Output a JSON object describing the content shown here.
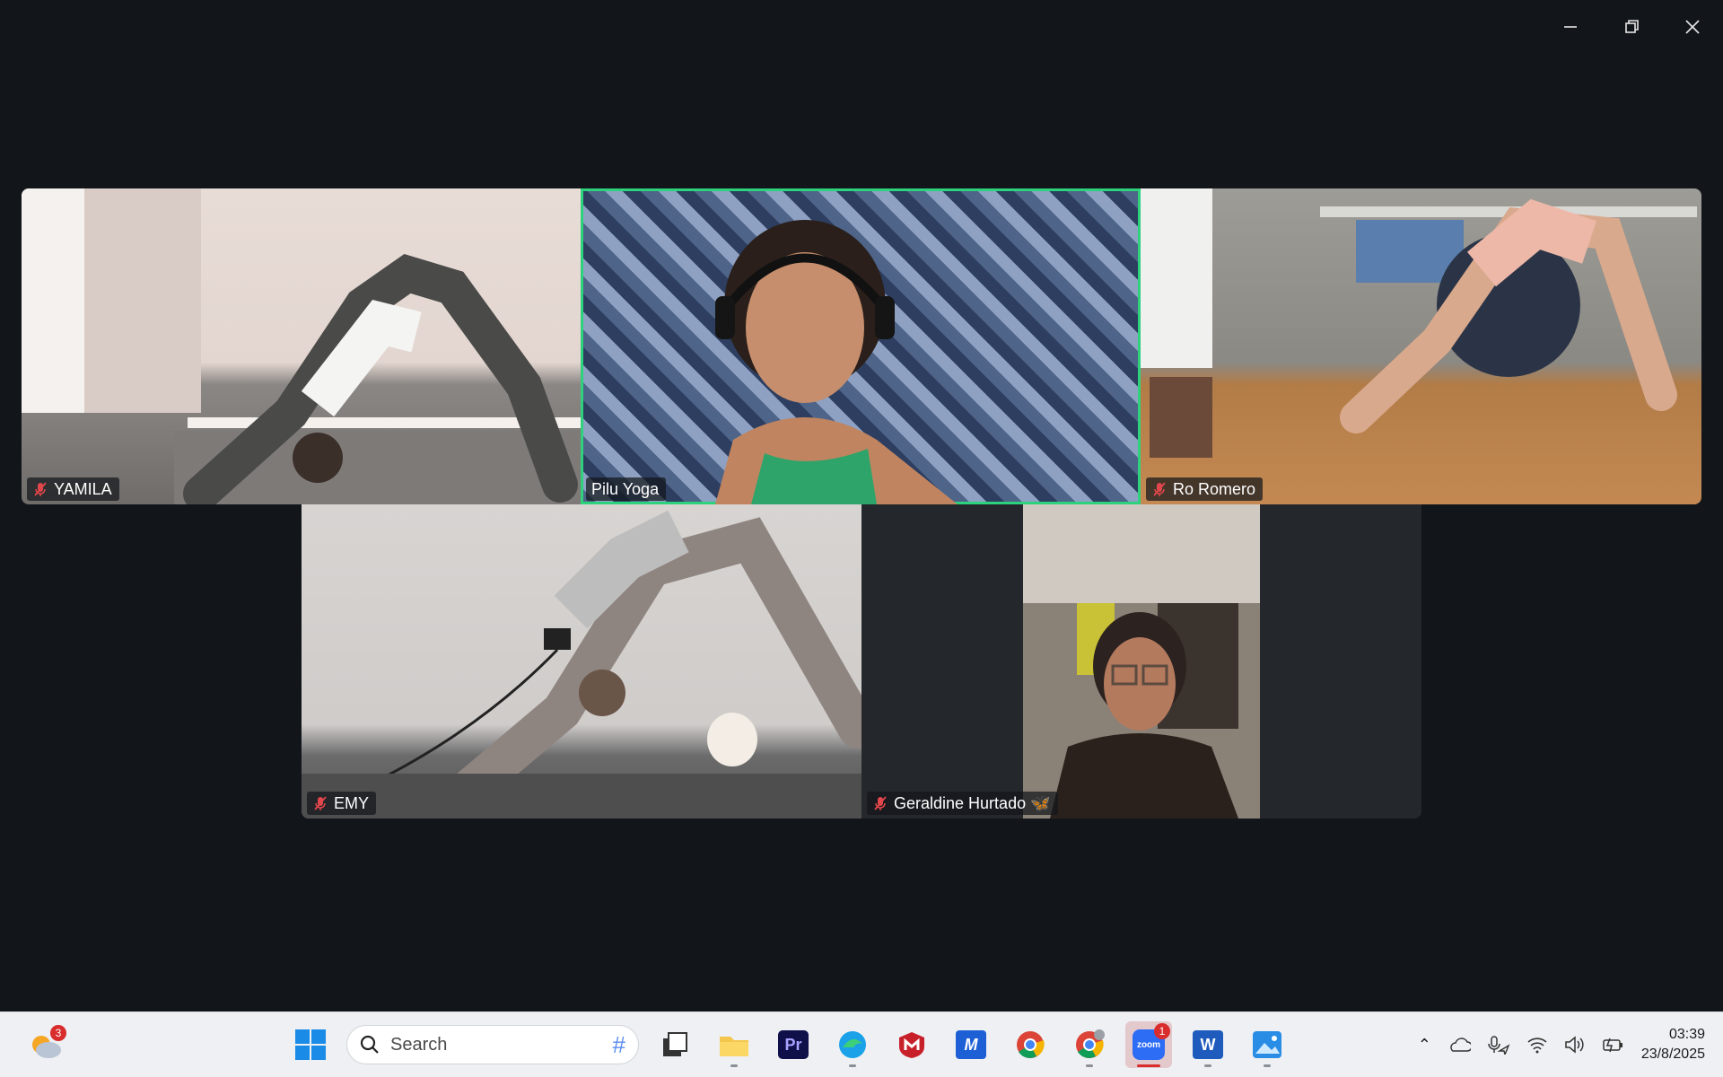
{
  "window": {
    "controls": [
      "minimize",
      "restore",
      "close"
    ]
  },
  "participants": [
    {
      "name": "YAMILA",
      "muted": true,
      "active": false
    },
    {
      "name": "Pilu Yoga",
      "muted": false,
      "active": true
    },
    {
      "name": "Ro Romero",
      "muted": true,
      "active": false
    },
    {
      "name": "EMY",
      "muted": true,
      "active": false
    },
    {
      "name": "Geraldine Hurtado 🦋",
      "muted": true,
      "active": false
    }
  ],
  "colors": {
    "background": "#12161b",
    "active_speaker": "#2fd27c",
    "mute_icon": "#e0464b",
    "taskbar": "#eef0f3"
  },
  "taskbar": {
    "weather_badge": "3",
    "search_placeholder": "Search",
    "apps": [
      "windows-start",
      "task-view",
      "file-explorer",
      "premiere-pro",
      "edge",
      "mcafee",
      "malwarebytes",
      "chrome",
      "chrome-profile",
      "zoom",
      "word",
      "photos"
    ],
    "zoom_badge": "1",
    "clock_time": "03:39",
    "clock_date": "23/8/2025"
  }
}
